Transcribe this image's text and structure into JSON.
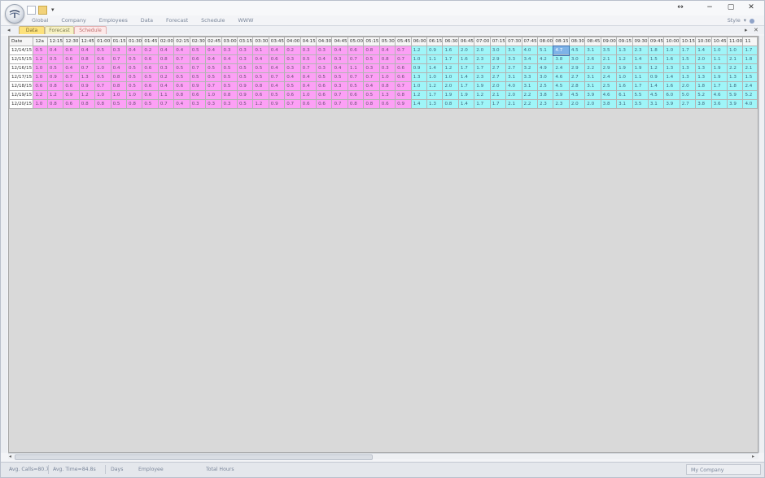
{
  "window": {
    "resize_glyph": "↔",
    "minimize_glyph": "−",
    "restore_glyph": "▢",
    "close_glyph": "✕"
  },
  "quick_access": {
    "more": "▾"
  },
  "ribbon": {
    "menu": [
      "Global",
      "Company",
      "Employees",
      "Data",
      "Forecast",
      "Schedule",
      "WWW"
    ],
    "style_label": "Style",
    "style_arrow": "▾"
  },
  "sheet_tabs": {
    "nav_left": "◂",
    "tabs": [
      "Data",
      "Forecast",
      "Schedule"
    ],
    "nav_right": "▸",
    "close": "✕"
  },
  "grid": {
    "headers": [
      "Date",
      "12a",
      "12:15",
      "12:30",
      "12:45",
      "01:00",
      "01:15",
      "01:30",
      "01:45",
      "02:00",
      "02:15",
      "02:30",
      "02:45",
      "03:00",
      "03:15",
      "03:30",
      "03:45",
      "04:00",
      "04:15",
      "04:30",
      "04:45",
      "05:00",
      "05:15",
      "05:30",
      "05:45",
      "06:00",
      "06:15",
      "06:30",
      "06:45",
      "07:00",
      "07:15",
      "07:30",
      "07:45",
      "08:00",
      "08:15",
      "08:30",
      "08:45",
      "09:00",
      "09:15",
      "09:30",
      "09:45",
      "10:00",
      "10:15",
      "10:30",
      "10:45",
      "11:00",
      "11"
    ],
    "pink_columns": 24,
    "selected": {
      "row": 0,
      "col": 33
    },
    "rows": [
      {
        "date": "12/14/15",
        "values": [
          "0.5",
          "0.4",
          "0.6",
          "0.4",
          "0.5",
          "0.3",
          "0.4",
          "0.2",
          "0.4",
          "0.4",
          "0.5",
          "0.4",
          "0.3",
          "0.3",
          "0.1",
          "0.4",
          "0.2",
          "0.3",
          "0.3",
          "0.4",
          "0.6",
          "0.8",
          "0.4",
          "0.7",
          "1.2",
          "0.9",
          "1.6",
          "2.0",
          "2.0",
          "3.0",
          "3.5",
          "4.0",
          "5.1",
          "4.7",
          "4.5",
          "3.1",
          "3.5",
          "1.3",
          "2.3",
          "1.8",
          "1.0",
          "1.7",
          "1.4",
          "1.0",
          "1.0",
          "1.7"
        ]
      },
      {
        "date": "12/15/15",
        "values": [
          "1.2",
          "0.5",
          "0.6",
          "0.8",
          "0.6",
          "0.7",
          "0.5",
          "0.6",
          "0.8",
          "0.7",
          "0.6",
          "0.4",
          "0.4",
          "0.3",
          "0.4",
          "0.6",
          "0.3",
          "0.5",
          "0.4",
          "0.3",
          "0.7",
          "0.5",
          "0.8",
          "0.7",
          "1.0",
          "1.1",
          "1.7",
          "1.6",
          "2.3",
          "2.9",
          "3.3",
          "3.4",
          "4.2",
          "3.8",
          "3.0",
          "2.6",
          "2.1",
          "1.2",
          "1.4",
          "1.5",
          "1.6",
          "1.5",
          "2.0",
          "1.1",
          "2.1",
          "1.8"
        ]
      },
      {
        "date": "12/16/15",
        "values": [
          "1.0",
          "0.5",
          "0.4",
          "0.7",
          "1.0",
          "0.4",
          "0.5",
          "0.6",
          "0.3",
          "0.5",
          "0.7",
          "0.5",
          "0.5",
          "0.5",
          "0.5",
          "0.4",
          "0.3",
          "0.7",
          "0.3",
          "0.4",
          "1.1",
          "0.3",
          "0.3",
          "0.6",
          "0.9",
          "1.4",
          "1.2",
          "1.7",
          "1.7",
          "2.7",
          "2.7",
          "3.2",
          "4.9",
          "2.4",
          "2.9",
          "2.2",
          "2.9",
          "1.9",
          "1.9",
          "1.2",
          "1.3",
          "1.3",
          "1.3",
          "1.9",
          "2.2",
          "2.1"
        ]
      },
      {
        "date": "12/17/15",
        "values": [
          "1.0",
          "0.9",
          "0.7",
          "1.3",
          "0.5",
          "0.8",
          "0.5",
          "0.5",
          "0.2",
          "0.5",
          "0.5",
          "0.5",
          "0.5",
          "0.5",
          "0.5",
          "0.7",
          "0.4",
          "0.4",
          "0.5",
          "0.5",
          "0.7",
          "0.7",
          "1.0",
          "0.6",
          "1.3",
          "1.0",
          "1.0",
          "1.4",
          "2.3",
          "2.7",
          "3.1",
          "3.3",
          "3.0",
          "4.6",
          "2.7",
          "3.1",
          "2.4",
          "1.0",
          "1.1",
          "0.9",
          "1.4",
          "1.3",
          "1.3",
          "1.9",
          "1.3",
          "1.5"
        ]
      },
      {
        "date": "12/18/15",
        "values": [
          "0.6",
          "0.8",
          "0.6",
          "0.9",
          "0.7",
          "0.8",
          "0.5",
          "0.6",
          "0.4",
          "0.6",
          "0.9",
          "0.7",
          "0.5",
          "0.9",
          "0.8",
          "0.4",
          "0.5",
          "0.4",
          "0.6",
          "0.3",
          "0.5",
          "0.4",
          "0.8",
          "0.7",
          "1.0",
          "1.2",
          "2.0",
          "1.7",
          "1.9",
          "2.0",
          "4.0",
          "3.1",
          "2.5",
          "4.5",
          "2.8",
          "3.1",
          "2.5",
          "1.6",
          "1.7",
          "1.4",
          "1.6",
          "2.0",
          "1.8",
          "1.7",
          "1.8",
          "2.4"
        ]
      },
      {
        "date": "12/19/15",
        "values": [
          "1.2",
          "1.2",
          "0.9",
          "1.2",
          "1.0",
          "1.0",
          "1.0",
          "0.6",
          "1.1",
          "0.8",
          "0.6",
          "1.0",
          "0.8",
          "0.9",
          "0.6",
          "0.5",
          "0.6",
          "1.0",
          "0.6",
          "0.7",
          "0.6",
          "0.5",
          "1.3",
          "0.8",
          "1.2",
          "1.7",
          "1.9",
          "1.9",
          "1.2",
          "2.1",
          "2.0",
          "2.2",
          "3.8",
          "3.9",
          "4.5",
          "3.9",
          "4.6",
          "6.1",
          "5.5",
          "4.5",
          "6.0",
          "5.0",
          "5.2",
          "4.6",
          "5.9",
          "5.2"
        ]
      },
      {
        "date": "12/20/15",
        "values": [
          "1.0",
          "0.8",
          "0.6",
          "0.8",
          "0.8",
          "0.5",
          "0.8",
          "0.5",
          "0.7",
          "0.4",
          "0.3",
          "0.3",
          "0.3",
          "0.5",
          "1.2",
          "0.9",
          "0.7",
          "0.6",
          "0.6",
          "0.7",
          "0.8",
          "0.8",
          "0.6",
          "0.9",
          "1.4",
          "1.3",
          "0.8",
          "1.4",
          "1.7",
          "1.7",
          "2.1",
          "2.2",
          "2.3",
          "2.3",
          "2.0",
          "2.0",
          "3.8",
          "3.1",
          "3.5",
          "3.1",
          "3.9",
          "2.7",
          "3.8",
          "3.6",
          "3.9",
          "4.0"
        ]
      }
    ]
  },
  "statusbar": {
    "avg_calls": "Avg. Calls=80.7",
    "avg_time": "Avg. Time=84.8s",
    "days": "Days",
    "employee": "Employee",
    "total_hours": "Total Hours",
    "company": "My Company"
  }
}
